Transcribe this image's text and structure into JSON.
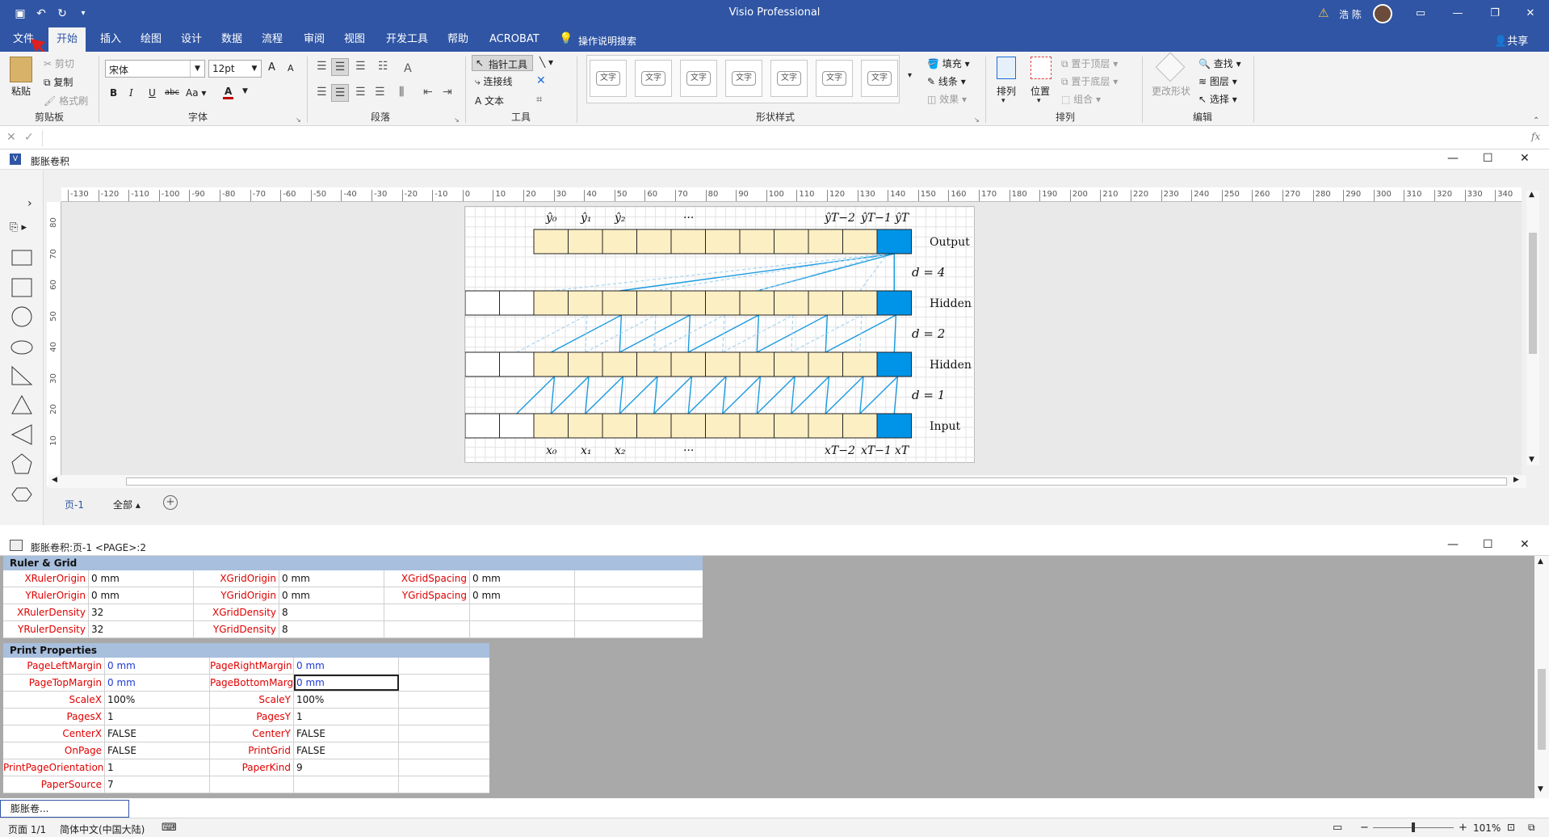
{
  "app": {
    "title": "Visio Professional",
    "user": "浩 陈",
    "share_label": "共享"
  },
  "tabs": [
    "文件",
    "开始",
    "插入",
    "绘图",
    "设计",
    "数据",
    "流程",
    "审阅",
    "视图",
    "开发工具",
    "帮助",
    "ACROBAT"
  ],
  "tell_me": "操作说明搜索",
  "ribbon": {
    "clipboard": {
      "paste": "粘贴",
      "cut": "剪切",
      "copy": "复制",
      "format_painter": "格式刷",
      "label": "剪贴板"
    },
    "font": {
      "name": "宋体",
      "size": "12pt",
      "bold": "B",
      "italic": "I",
      "underline": "U",
      "strike": "abc",
      "case": "Aa",
      "color": "A",
      "grow": "A",
      "shrink": "A",
      "label": "字体"
    },
    "paragraph": {
      "label": "段落"
    },
    "tools": {
      "pointer": "指针工具",
      "connector": "连接线",
      "text": "文本",
      "label": "工具"
    },
    "shape_styles": {
      "items": [
        "文字",
        "文字",
        "文字",
        "文字",
        "文字",
        "文字",
        "文字"
      ],
      "fill": "填充",
      "line": "线条",
      "effects": "效果",
      "label": "形状样式"
    },
    "arrange": {
      "arrange": "排列",
      "position": "位置",
      "bring_front": "置于顶层",
      "send_back": "置于底层",
      "group": "组合",
      "label": "排列"
    },
    "editing": {
      "change_shape": "更改形状",
      "find": "查找",
      "layers": "图层",
      "select": "选择",
      "label": "编辑"
    }
  },
  "formula": {
    "fx": "fx"
  },
  "document": {
    "title": "膨胀卷积"
  },
  "page_tabs": {
    "page": "页-1",
    "all": "全部"
  },
  "diagram": {
    "y_labels": [
      "ŷ₀",
      "ŷ₁",
      "ŷ₂",
      "···",
      "ŷT−2",
      "ŷT−1",
      "ŷT"
    ],
    "x_labels": [
      "x₀",
      "x₁",
      "x₂",
      "···",
      "xT−2",
      "xT−1",
      "xT"
    ],
    "row_labels": [
      "Output",
      "Hidden",
      "Hidden",
      "Input"
    ],
    "d_labels": [
      "d = 4",
      "d = 2",
      "d = 1"
    ],
    "colors": {
      "cell": "#fcefc3",
      "highlight": "#0094e8",
      "line": "#1a9be0",
      "dashed": "#a9d5ef"
    }
  },
  "ruler": {
    "h_ticks": [
      "-130",
      "-120",
      "-110",
      "-100",
      "-90",
      "-80",
      "-70",
      "-60",
      "-50",
      "-40",
      "-30",
      "-20",
      "-10",
      "0",
      "10",
      "20",
      "30",
      "40",
      "50",
      "60",
      "70",
      "80",
      "90",
      "100",
      "110",
      "120",
      "130",
      "140",
      "150",
      "160",
      "170",
      "180",
      "190",
      "200",
      "210",
      "220",
      "230",
      "240",
      "250",
      "260",
      "270",
      "280",
      "290",
      "300",
      "310",
      "320",
      "330",
      "340"
    ],
    "v_ticks": [
      "80",
      "70",
      "60",
      "50",
      "40",
      "30",
      "20",
      "10"
    ]
  },
  "shapesheet": {
    "title": "膨胀卷积:页-1  <PAGE>:2",
    "ruler_grid": {
      "header": "Ruler & Grid",
      "rows": [
        [
          [
            "XRulerOrigin",
            "0 mm"
          ],
          [
            "XGridOrigin",
            "0 mm"
          ],
          [
            "XGridSpacing",
            "0 mm"
          ]
        ],
        [
          [
            "YRulerOrigin",
            "0 mm"
          ],
          [
            "YGridOrigin",
            "0 mm"
          ],
          [
            "YGridSpacing",
            "0 mm"
          ]
        ],
        [
          [
            "XRulerDensity",
            "32"
          ],
          [
            "XGridDensity",
            "8"
          ],
          [
            "",
            ""
          ]
        ],
        [
          [
            "YRulerDensity",
            "32"
          ],
          [
            "YGridDensity",
            "8"
          ],
          [
            "",
            ""
          ]
        ]
      ]
    },
    "print": {
      "header": "Print Properties",
      "rows": [
        [
          [
            "PageLeftMargin",
            "0 mm"
          ],
          [
            "PageRightMargin",
            "0 mm"
          ]
        ],
        [
          [
            "PageTopMargin",
            "0 mm"
          ],
          [
            "PageBottomMargin",
            "0 mm"
          ]
        ],
        [
          [
            "ScaleX",
            "100%"
          ],
          [
            "ScaleY",
            "100%"
          ]
        ],
        [
          [
            "PagesX",
            "1"
          ],
          [
            "PagesY",
            "1"
          ]
        ],
        [
          [
            "CenterX",
            "FALSE"
          ],
          [
            "CenterY",
            "FALSE"
          ]
        ],
        [
          [
            "OnPage",
            "FALSE"
          ],
          [
            "PrintGrid",
            "FALSE"
          ]
        ],
        [
          [
            "PrintPageOrientation",
            "1"
          ],
          [
            "PaperKind",
            "9"
          ]
        ],
        [
          [
            "PaperSource",
            "7"
          ],
          [
            "",
            ""
          ]
        ]
      ]
    }
  },
  "bottom": {
    "tab": "膨胀卷..."
  },
  "status": {
    "page": "页面 1/1",
    "lang": "简体中文(中国大陆)",
    "zoom": "101%"
  }
}
